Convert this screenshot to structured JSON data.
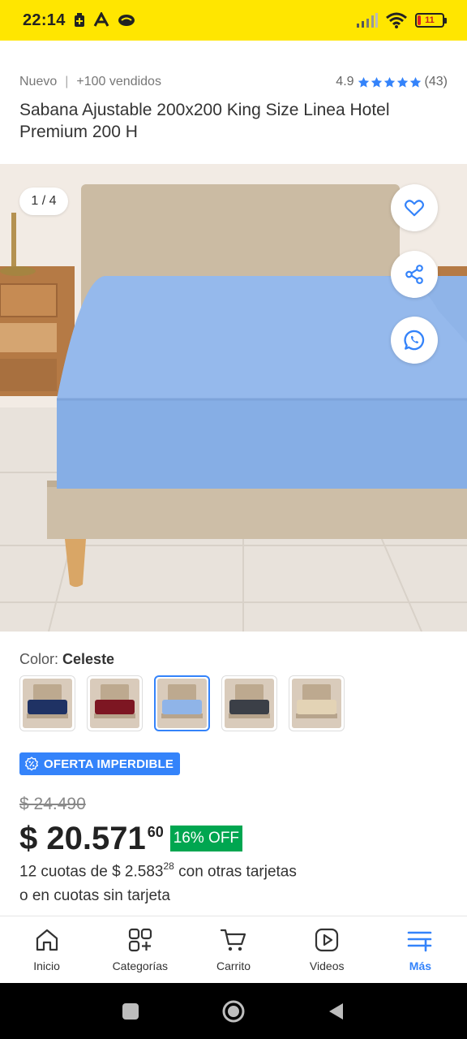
{
  "status_bar": {
    "time": "22:14",
    "battery_level": "11",
    "background_color": "#ffe600"
  },
  "product": {
    "condition": "Nuevo",
    "separator": "|",
    "sold": "+100 vendidos",
    "rating": "4.9",
    "stars": 5,
    "reviews": "(43)",
    "title": "Sabana Ajustable 200x200 King Size Linea Hotel Premium 200 H"
  },
  "gallery": {
    "counter": "1 / 4",
    "actions": [
      "heart-icon",
      "share-icon",
      "whatsapp-icon"
    ]
  },
  "color": {
    "label": "Color:",
    "selected": "Celeste",
    "swatches": [
      {
        "sheet_color": "#1f3264"
      },
      {
        "sheet_color": "#7d1622"
      },
      {
        "sheet_color": "#8fb4e8",
        "selected": true
      },
      {
        "sheet_color": "#3b3f47"
      },
      {
        "sheet_color": "#e3d3b5"
      }
    ]
  },
  "offer": {
    "badge": "OFERTA IMPERDIBLE",
    "old_price": "$ 24.490",
    "price": "$ 20.571",
    "cents": "60",
    "discount": "16% OFF",
    "installments_prefix": "12 cuotas de $ 2.583",
    "installments_cents": "28",
    "installments_suffix": " con otras tarjetas",
    "no_card": "o en cuotas sin tarjeta"
  },
  "nav": {
    "items": [
      {
        "label": "Inicio",
        "icon": "home-icon"
      },
      {
        "label": "Categorías",
        "icon": "categories-icon"
      },
      {
        "label": "Carrito",
        "icon": "cart-icon"
      },
      {
        "label": "Videos",
        "icon": "play-icon"
      },
      {
        "label": "Más",
        "icon": "more-icon",
        "active": true
      }
    ]
  },
  "colors": {
    "accent": "#3483fa",
    "discount": "#00a650",
    "sheet": "#8fb4e8"
  }
}
